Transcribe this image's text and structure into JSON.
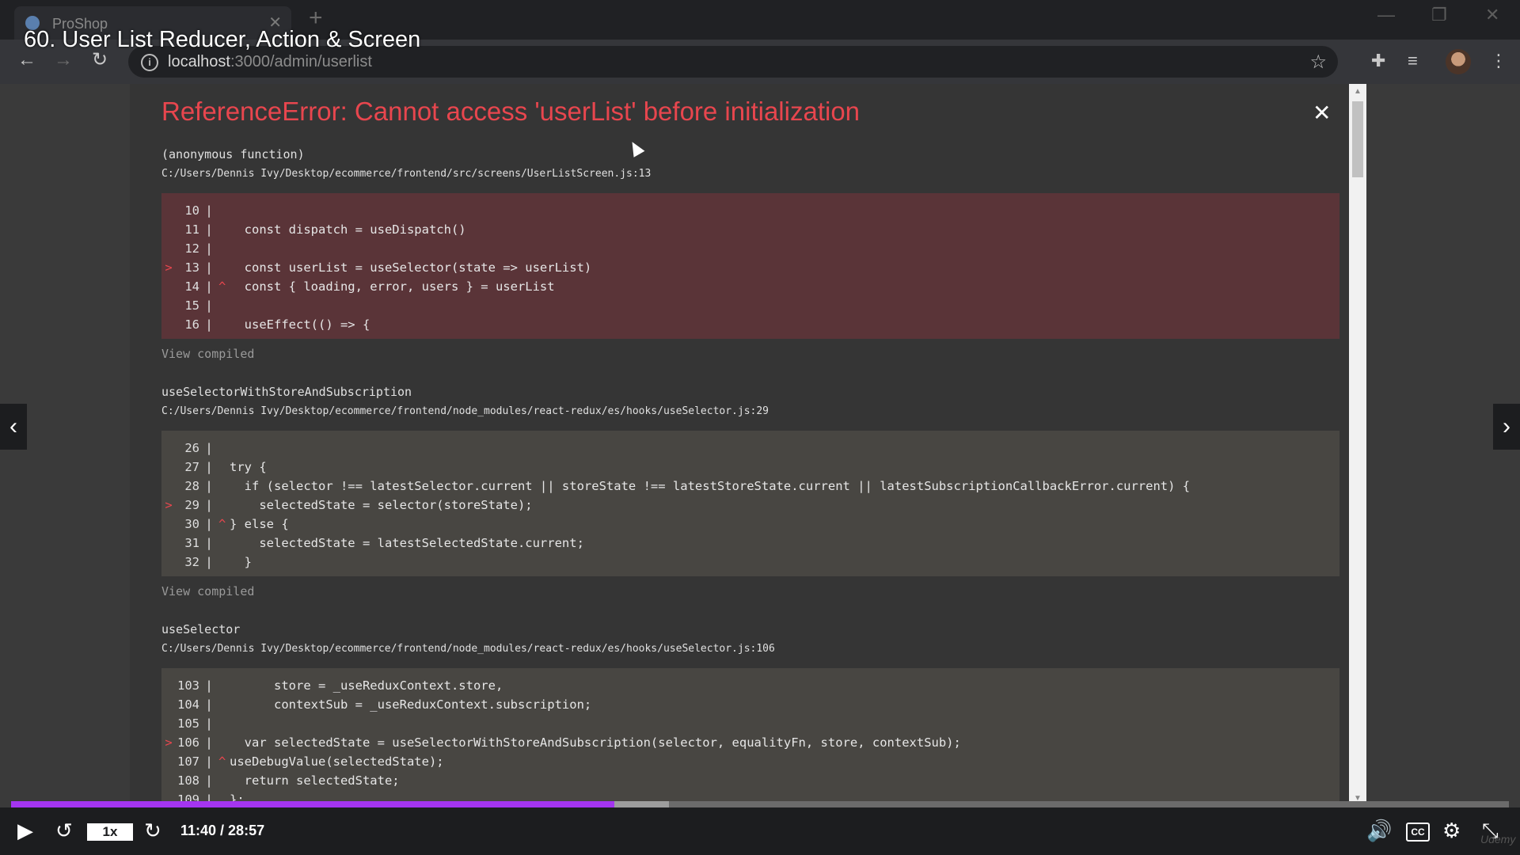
{
  "browser": {
    "tab_title": "ProShop",
    "url_host": "localhost",
    "url_path": ":3000/admin/userlist"
  },
  "video_title": "60. User List Reducer, Action & Screen",
  "error": {
    "title": "ReferenceError: Cannot access 'userList' before initialization",
    "view_compiled": "View compiled",
    "frames": [
      {
        "fn": "(anonymous function)",
        "file": "C:/Users/Dennis Ivy/Desktop/ecommerce/frontend/src/screens/UserListScreen.js:13",
        "lines": [
          {
            "n": "10",
            "code": ""
          },
          {
            "n": "11",
            "code": "  const dispatch = useDispatch()"
          },
          {
            "n": "12",
            "code": ""
          },
          {
            "n": "13",
            "code": "  const userList = useSelector(state => userList)",
            "mark": ">"
          },
          {
            "n": "14",
            "code": "  const { loading, error, users } = userList",
            "caret": "^"
          },
          {
            "n": "15",
            "code": ""
          },
          {
            "n": "16",
            "code": "  useEffect(() => {"
          }
        ]
      },
      {
        "fn": "useSelectorWithStoreAndSubscription",
        "file": "C:/Users/Dennis Ivy/Desktop/ecommerce/frontend/node_modules/react-redux/es/hooks/useSelector.js:29",
        "lines": [
          {
            "n": "26",
            "code": ""
          },
          {
            "n": "27",
            "code": "try {"
          },
          {
            "n": "28",
            "code": "  if (selector !== latestSelector.current || storeState !== latestStoreState.current || latestSubscriptionCallbackError.current) {"
          },
          {
            "n": "29",
            "code": "    selectedState = selector(storeState);",
            "mark": ">"
          },
          {
            "n": "30",
            "code": "} else {",
            "caret": "^"
          },
          {
            "n": "31",
            "code": "    selectedState = latestSelectedState.current;"
          },
          {
            "n": "32",
            "code": "  }"
          }
        ]
      },
      {
        "fn": "useSelector",
        "file": "C:/Users/Dennis Ivy/Desktop/ecommerce/frontend/node_modules/react-redux/es/hooks/useSelector.js:106",
        "lines": [
          {
            "n": "103",
            "code": "      store = _useReduxContext.store,"
          },
          {
            "n": "104",
            "code": "      contextSub = _useReduxContext.subscription;"
          },
          {
            "n": "105",
            "code": ""
          },
          {
            "n": "106",
            "code": "  var selectedState = useSelectorWithStoreAndSubscription(selector, equalityFn, store, contextSub);",
            "mark": ">"
          },
          {
            "n": "107",
            "code": "useDebugValue(selectedState);",
            "caret": "^"
          },
          {
            "n": "108",
            "code": "  return selectedState;"
          },
          {
            "n": "109",
            "code": "};"
          }
        ]
      }
    ]
  },
  "player": {
    "speed": "1x",
    "time": "11:40 / 28:57",
    "progress": 0.403,
    "buffered": 0.439,
    "cc_label": "CC",
    "watermark": "Udemy"
  },
  "colors": {
    "error_red": "#e8464e",
    "progress_purple": "#a435f0"
  }
}
